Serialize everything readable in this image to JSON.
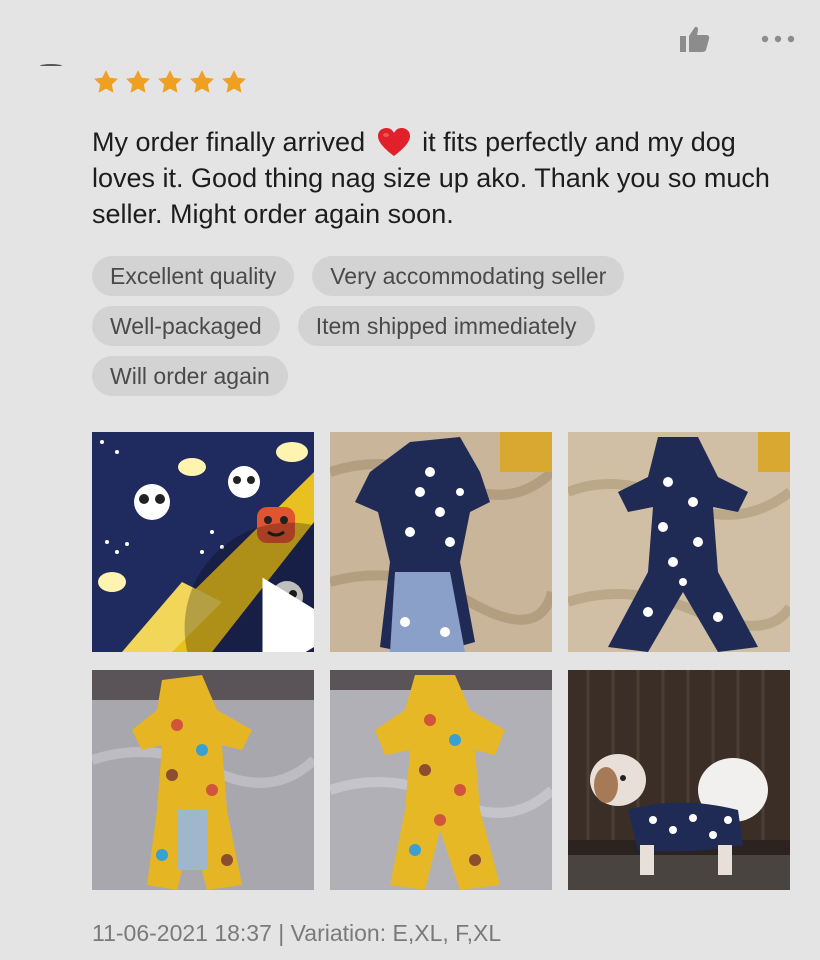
{
  "review": {
    "rating": 5,
    "rating_max": 5,
    "text_before_heart": "My order finally arrived",
    "text_after_heart": "it fits perfectly and my dog loves it. Good thing nag size up ako. Thank you so much seller. Might order again soon.",
    "heart_icon": "red-heart-emoji"
  },
  "tags": [
    [
      "Excellent quality",
      "Very accommodating seller"
    ],
    [
      "Well-packaged",
      "Item shipped immediately"
    ],
    [
      "Will order again"
    ]
  ],
  "media": [
    {
      "type": "video",
      "icon": "play-icon"
    },
    {
      "type": "image"
    },
    {
      "type": "image"
    },
    {
      "type": "image"
    },
    {
      "type": "image"
    },
    {
      "type": "image"
    }
  ],
  "footer": {
    "datetime": "11-06-2021 18:37",
    "separator": " | ",
    "variation": "Variation: E,XL, F,XL"
  },
  "actions": {
    "like_icon": "thumbs-up-icon",
    "more_icon": "more-dots-icon"
  },
  "colors": {
    "background": "#e4e4e4",
    "star": "#f0a020",
    "heart": "#e0202a",
    "tag_bg": "#d3d3d3",
    "meta_text": "#7a7a7a"
  }
}
